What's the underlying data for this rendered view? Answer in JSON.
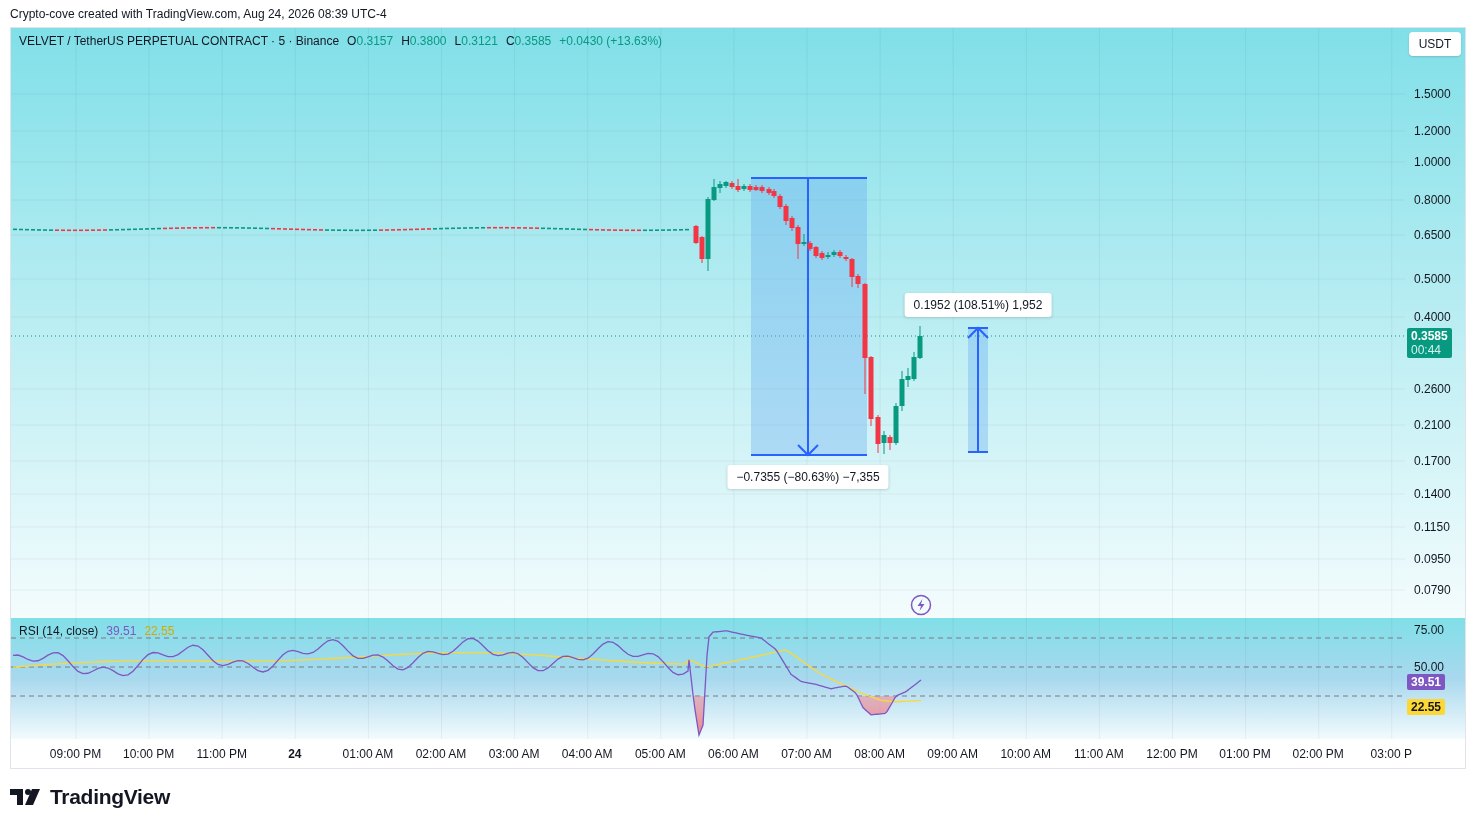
{
  "header": {
    "text": "Crypto-cove created with TradingView.com, Aug 24, 2026 08:39 UTC-4"
  },
  "legend": {
    "symbol": "VELVET / TetherUS PERPETUAL CONTRACT · 5 · Binance",
    "ohlc": [
      {
        "key": "O",
        "value": "0.3157"
      },
      {
        "key": "H",
        "value": "0.3800"
      },
      {
        "key": "L",
        "value": "0.3121"
      },
      {
        "key": "C",
        "value": "0.3585"
      }
    ],
    "change": "+0.0430 (+13.63%)"
  },
  "currency_button": "USDT",
  "price_axis": [
    "1.5000",
    "1.2000",
    "1.0000",
    "0.8000",
    "0.6500",
    "0.5000",
    "0.4000",
    "0.2600",
    "0.2100",
    "0.1700",
    "0.1400",
    "0.1150",
    "0.0950",
    "0.0790"
  ],
  "last_price": {
    "price": "0.3585",
    "countdown": "00:44"
  },
  "measures": [
    {
      "kind": "down",
      "label": "−0.7355 (−80.63%) −7,355"
    },
    {
      "kind": "up",
      "label": "0.1952 (108.51%) 1,952"
    }
  ],
  "rsi": {
    "title": "RSI (14, close)",
    "value": "39.51",
    "ma_value": "22.55",
    "axis": [
      "75.00",
      "50.00"
    ],
    "badge_value": "39.51",
    "badge_ma_value": "22.55"
  },
  "time_axis": [
    {
      "label": "09:00 PM",
      "bold": false
    },
    {
      "label": "10:00 PM",
      "bold": false
    },
    {
      "label": "11:00 PM",
      "bold": false
    },
    {
      "label": "24",
      "bold": true
    },
    {
      "label": "01:00 AM",
      "bold": false
    },
    {
      "label": "02:00 AM",
      "bold": false
    },
    {
      "label": "03:00 AM",
      "bold": false
    },
    {
      "label": "04:00 AM",
      "bold": false
    },
    {
      "label": "05:00 AM",
      "bold": false
    },
    {
      "label": "06:00 AM",
      "bold": false
    },
    {
      "label": "07:00 AM",
      "bold": false
    },
    {
      "label": "08:00 AM",
      "bold": false
    },
    {
      "label": "09:00 AM",
      "bold": false
    },
    {
      "label": "10:00 AM",
      "bold": false
    },
    {
      "label": "11:00 AM",
      "bold": false
    },
    {
      "label": "12:00 PM",
      "bold": false
    },
    {
      "label": "01:00 PM",
      "bold": false
    },
    {
      "label": "02:00 PM",
      "bold": false
    },
    {
      "label": "03:00 P",
      "bold": false
    }
  ],
  "brand": "TradingView"
}
